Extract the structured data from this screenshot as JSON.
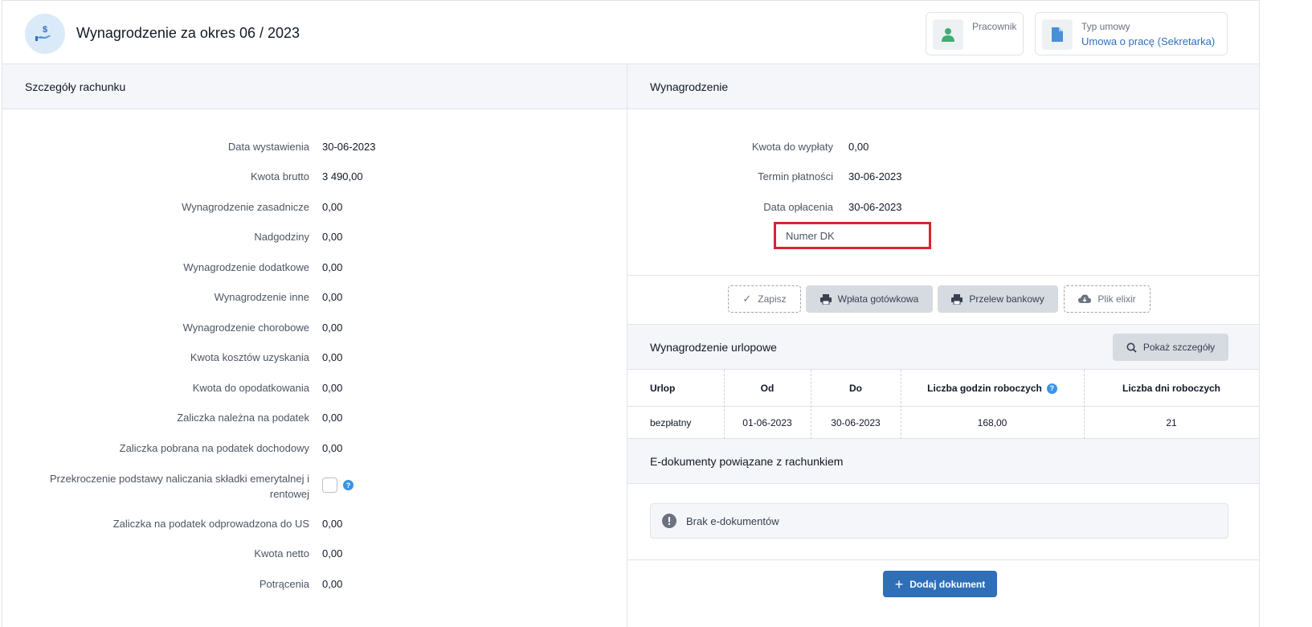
{
  "header": {
    "title": "Wynagrodzenie za okres 06 / 2023",
    "employee_label": "Pracownik",
    "contract_label": "Typ umowy",
    "contract_value": "Umowa o pracę (Sekretarka)"
  },
  "left": {
    "heading": "Szczegóły rachunku",
    "fields": [
      {
        "label": "Data wystawienia",
        "value": "30-06-2023"
      },
      {
        "label": "Kwota brutto",
        "value": "3 490,00"
      },
      {
        "label": "Wynagrodzenie zasadnicze",
        "value": "0,00"
      },
      {
        "label": "Nadgodziny",
        "value": "0,00"
      },
      {
        "label": "Wynagrodzenie dodatkowe",
        "value": "0,00"
      },
      {
        "label": "Wynagrodzenie inne",
        "value": "0,00"
      },
      {
        "label": "Wynagrodzenie chorobowe",
        "value": "0,00"
      },
      {
        "label": "Kwota kosztów uzyskania",
        "value": "0,00"
      },
      {
        "label": "Kwota do opodatkowania",
        "value": "0,00"
      },
      {
        "label": "Zaliczka należna na podatek",
        "value": "0,00"
      },
      {
        "label": "Zaliczka pobrana na podatek dochodowy",
        "value": "0,00"
      }
    ],
    "exceed_label_line1": "Przekroczenie podstawy naliczania składki emerytalnej i",
    "exceed_label_line2": "rentowej",
    "fields_after": [
      {
        "label": "Zaliczka na podatek odprowadzona do US",
        "value": "0,00"
      },
      {
        "label": "Kwota netto",
        "value": "0,00"
      },
      {
        "label": "Potrącenia",
        "value": "0,00"
      }
    ]
  },
  "right": {
    "heading": "Wynagrodzenie",
    "fields": [
      {
        "label": "Kwota do wypłaty",
        "value": "0,00"
      },
      {
        "label": "Termin płatności",
        "value": "30-06-2023"
      },
      {
        "label": "Data opłacenia",
        "value": "30-06-2023"
      }
    ],
    "numer_dk_placeholder": "Numer DK",
    "buttons": {
      "save": "Zapisz",
      "cash": "Wpłata gotówkowa",
      "transfer": "Przelew bankowy",
      "elixir": "Plik elixir"
    },
    "vacation": {
      "heading": "Wynagrodzenie urlopowe",
      "show_details": "Pokaż szczegóły",
      "columns": [
        "Urlop",
        "Od",
        "Do",
        "Liczba godzin roboczych",
        "Liczba dni roboczych"
      ],
      "rows": [
        [
          "bezpłatny",
          "01-06-2023",
          "30-06-2023",
          "168,00",
          "21"
        ]
      ]
    },
    "edocs": {
      "heading": "E-dokumenty powiązane z rachunkiem",
      "empty": "Brak e-dokumentów",
      "add_button": "Dodaj dokument"
    }
  },
  "colors": {
    "accent": "#2f6fb8",
    "highlight_border": "#d9232e",
    "panel_head_bg": "#f4f6f9"
  }
}
